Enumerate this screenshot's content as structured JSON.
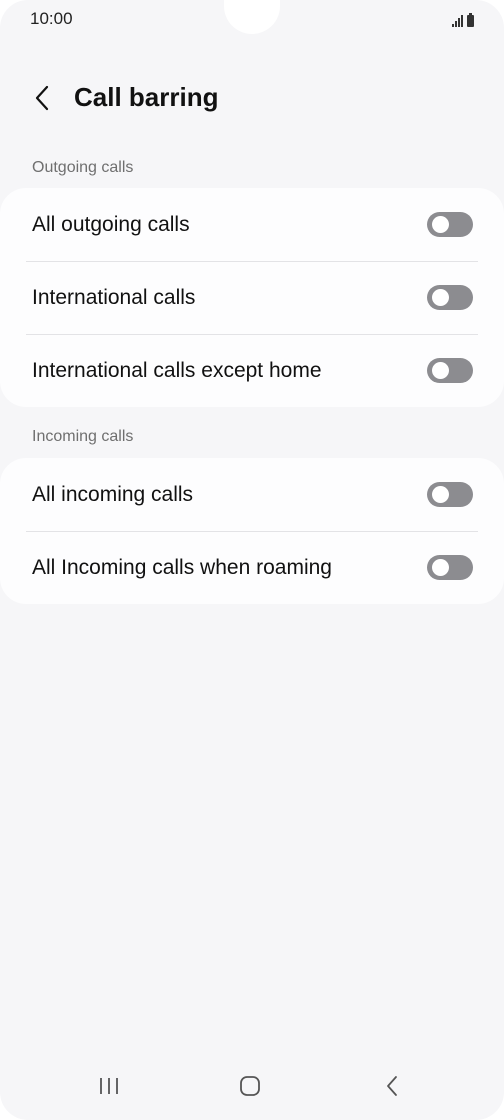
{
  "status_bar": {
    "time": "10:00"
  },
  "header": {
    "title": "Call barring",
    "back_icon": "chevron-left-icon"
  },
  "sections": [
    {
      "label": "Outgoing calls",
      "items": [
        {
          "label": "All outgoing calls",
          "enabled": false
        },
        {
          "label": "International calls",
          "enabled": false
        },
        {
          "label": "International calls except home",
          "enabled": false
        }
      ]
    },
    {
      "label": "Incoming calls",
      "items": [
        {
          "label": "All incoming calls",
          "enabled": false
        },
        {
          "label": "All Incoming calls when roaming",
          "enabled": false
        }
      ]
    }
  ],
  "navigation": {
    "recents_icon": "recents-icon",
    "home_icon": "home-icon",
    "back_icon": "back-icon"
  },
  "colors": {
    "background": "#f6f6f8",
    "card": "#fdfdfe",
    "toggle_off": "#8c8c90",
    "section_label": "#6f6f6f"
  }
}
